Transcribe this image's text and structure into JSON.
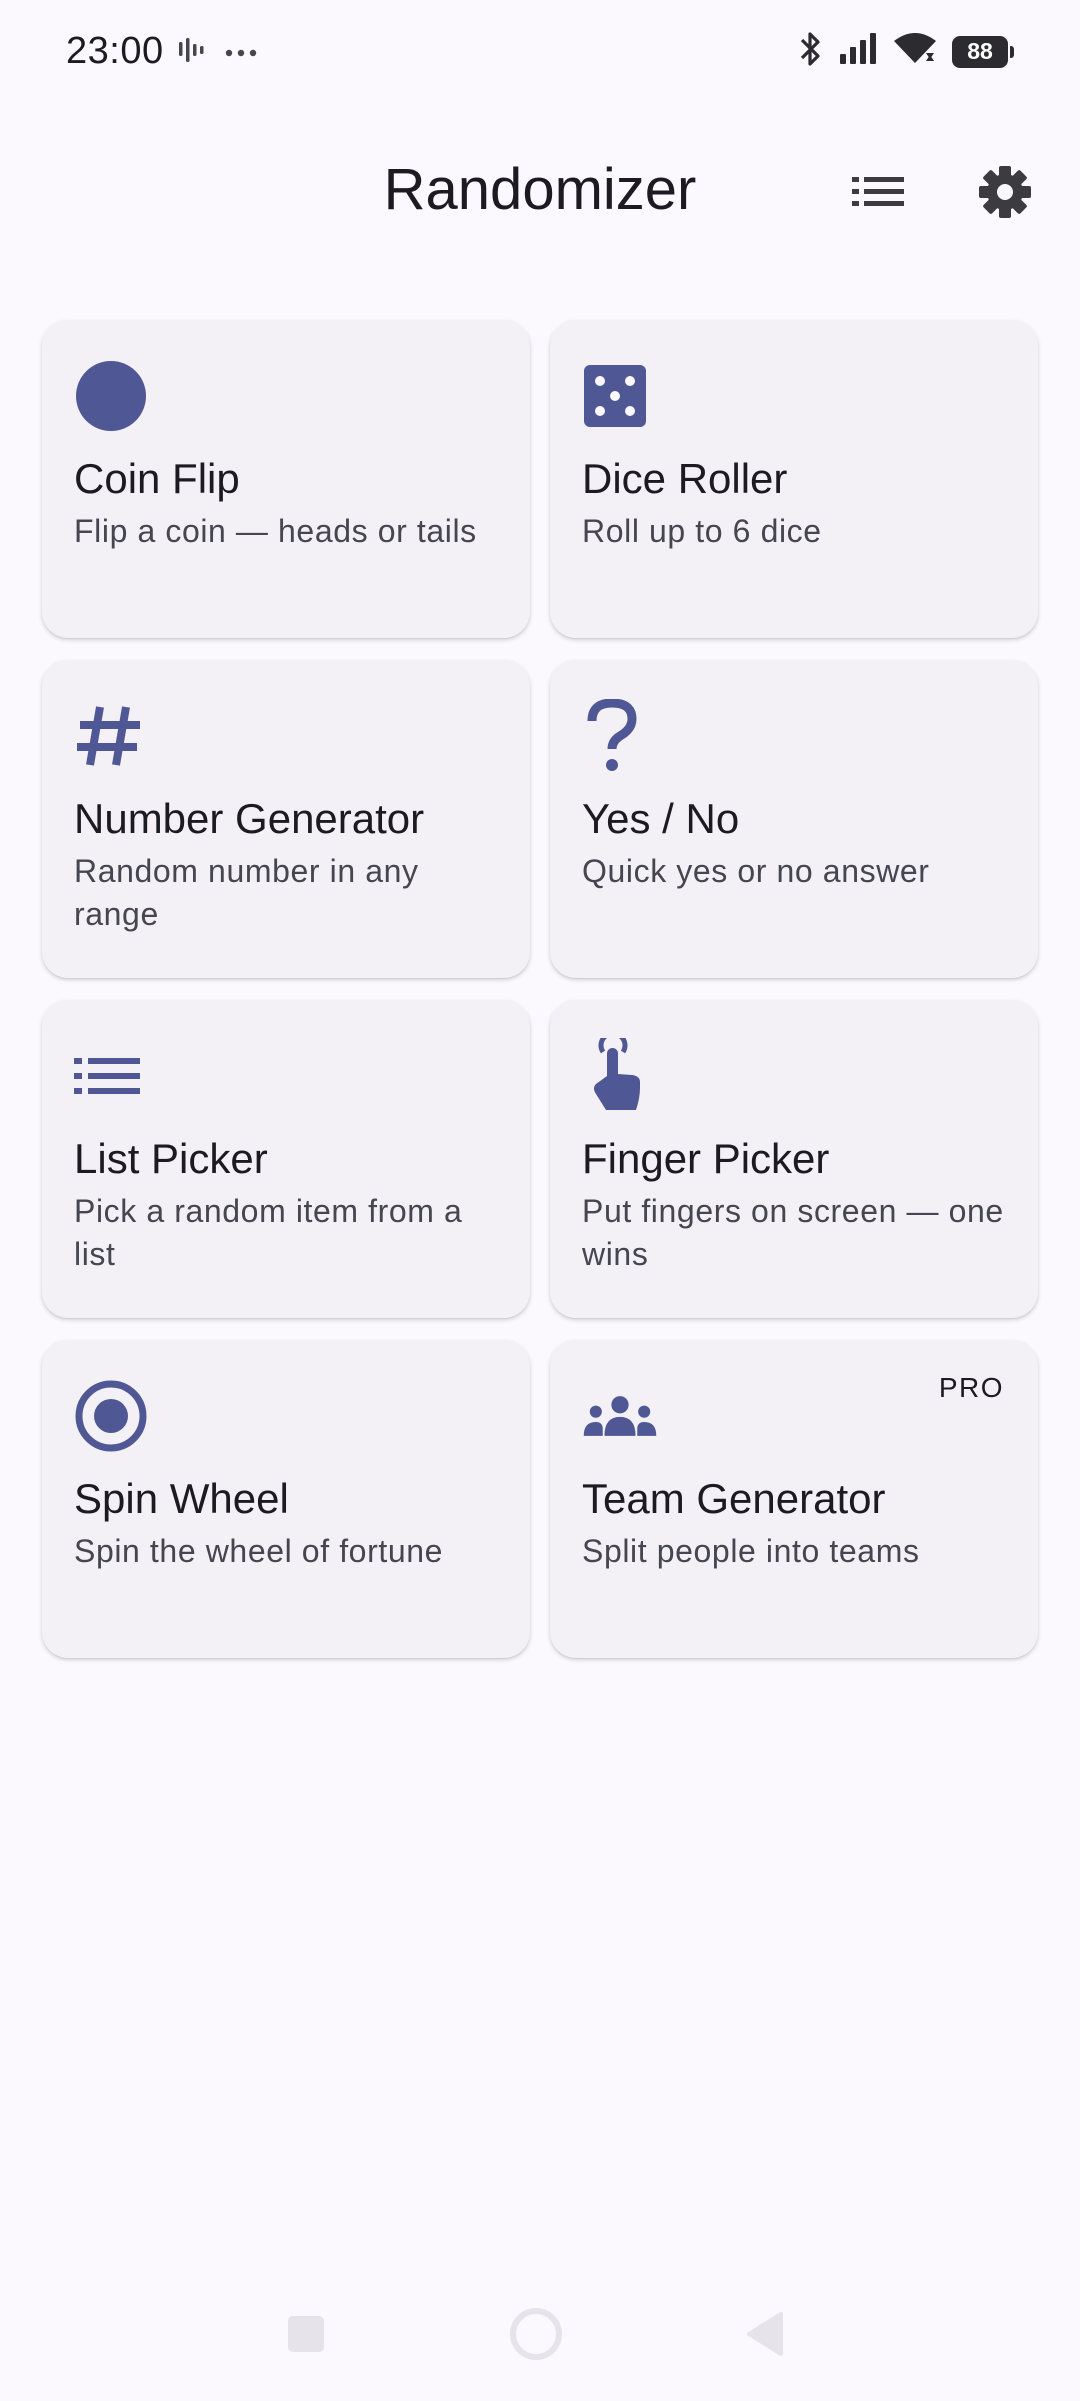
{
  "status_bar": {
    "time": "23:00",
    "battery": "88",
    "icons": [
      "voicemail-bars-icon",
      "more-dots-icon",
      "bluetooth-icon",
      "signal-icon",
      "wifi-icon",
      "battery-icon"
    ]
  },
  "app_bar": {
    "title": "Randomizer",
    "history_icon": "list-icon",
    "settings_icon": "gear-icon"
  },
  "tools": [
    {
      "title": "Coin Flip",
      "description": "Flip a coin — heads or tails",
      "icon": "coin-icon"
    },
    {
      "title": "Dice Roller",
      "description": "Roll up to 6 dice",
      "icon": "dice-icon"
    },
    {
      "title": "Number Generator",
      "description": "Random number in any range",
      "icon": "hash-icon"
    },
    {
      "title": "Yes / No",
      "description": "Quick yes or no answer",
      "icon": "question-icon"
    },
    {
      "title": "List Picker",
      "description": "Pick a random item from a list",
      "icon": "list-icon"
    },
    {
      "title": "Finger Picker",
      "description": "Put fingers on screen — one wins",
      "icon": "touch-icon"
    },
    {
      "title": "Spin Wheel",
      "description": "Spin the wheel of fortune",
      "icon": "target-icon"
    },
    {
      "title": "Team Generator",
      "description": "Split people into teams",
      "icon": "groups-icon",
      "badge": "PRO"
    }
  ],
  "colors": {
    "accent": "#4f5894",
    "background": "#fbf8fe",
    "card": "#f3f0f6",
    "text": "#1b1b21",
    "text_secondary": "#45464f"
  },
  "nav_bar": {
    "recents_icon": "square-icon",
    "home_icon": "circle-icon",
    "back_icon": "triangle-back-icon"
  }
}
